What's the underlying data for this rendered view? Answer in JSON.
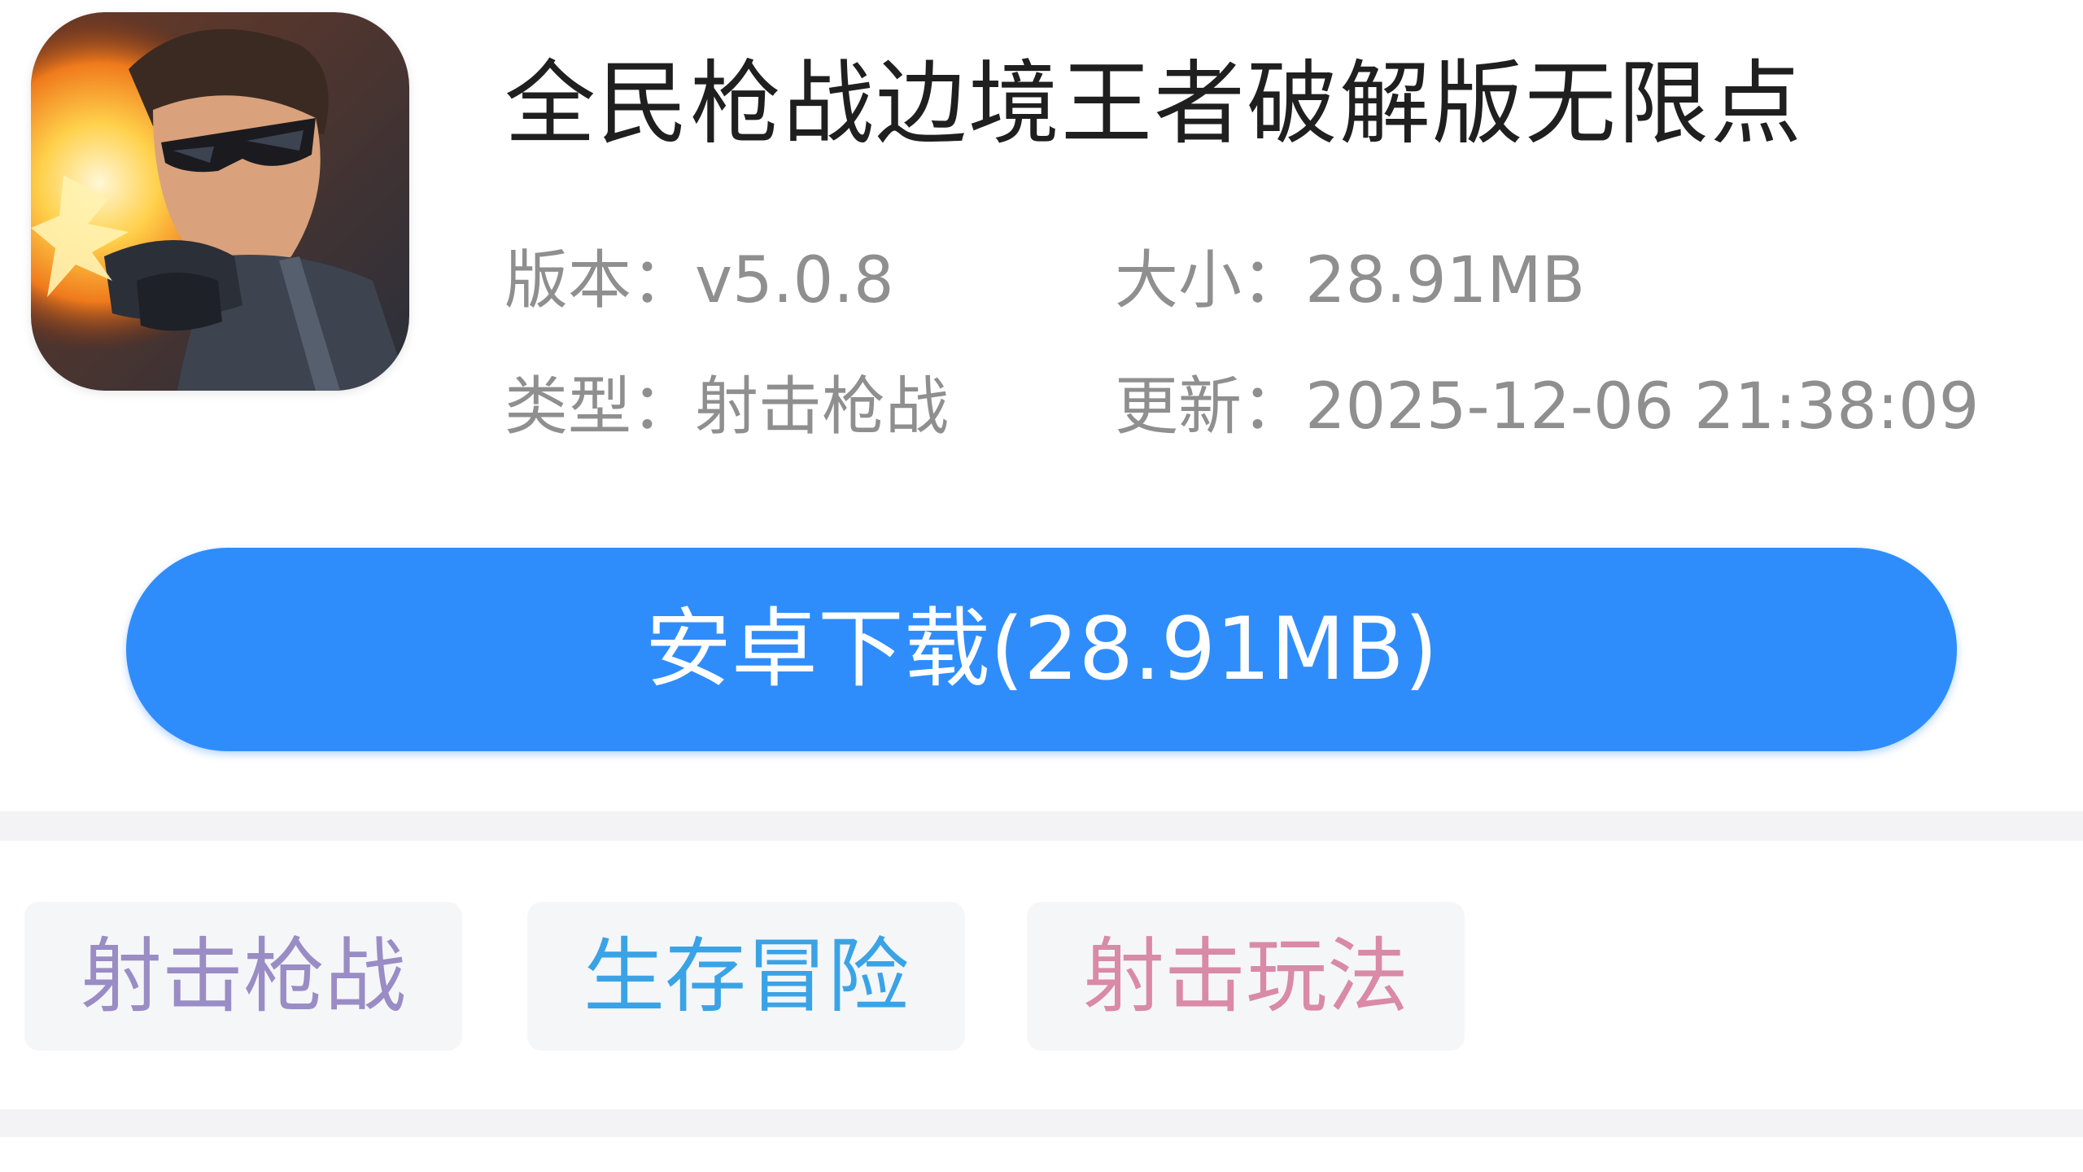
{
  "app": {
    "title": "全民枪战边境王者破解版无限点",
    "icon": "game-character-icon",
    "version_label": "版本：",
    "version_value": "v5.0.8",
    "size_label": "大小：",
    "size_value": "28.91MB",
    "type_label": "类型：",
    "type_value": "射击枪战",
    "update_label": "更新：",
    "update_value": "2025-12-06 21:38:09"
  },
  "download": {
    "label": "安卓下载(28.91MB)",
    "color": "#2f8dfb"
  },
  "tags": [
    {
      "label": "射击枪战",
      "color": "#9a8cc4"
    },
    {
      "label": "生存冒险",
      "color": "#3aa3e6"
    },
    {
      "label": "射击玩法",
      "color": "#d98aa6"
    }
  ]
}
